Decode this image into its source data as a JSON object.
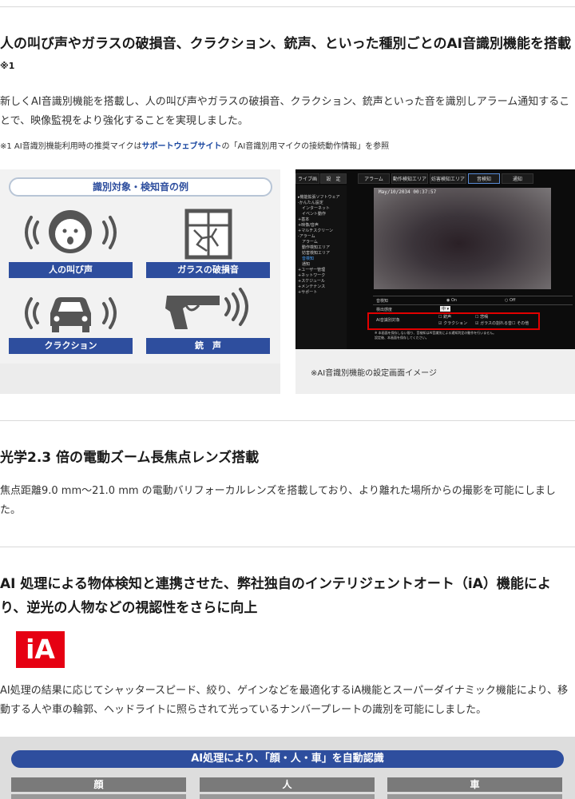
{
  "section1": {
    "heading": "人の叫び声やガラスの破損音、クラクション、銃声、といった種別ごとのAI音識別機能を搭載",
    "heading_sup": "※1",
    "body": "新しくAI音識別機能を搭載し、人の叫び声やガラスの破損音、クラクション、銃声といった音を識別しアラーム通知することで、映像監視をより強化することを実現しました。",
    "note_prefix": "※1 AI音識別機能利用時の推奨マイクは",
    "note_link": "サポートウェブサイト",
    "note_suffix": "の「AI音識別用マイクの接続動作情報」を参照"
  },
  "diagram": {
    "title": "識別対象・検知音の例",
    "items": [
      "人の叫び声",
      "ガラスの破損音",
      "クラクション",
      "銃　声"
    ]
  },
  "screenshot": {
    "tabs": [
      "ライブ画",
      "設　定",
      "アラーム",
      "動作検知エリア",
      "妨害検知エリア",
      "音検知",
      "通知"
    ],
    "sidebar": [
      "▸機能拡張ソフトウェア",
      "",
      "-かんたん設定",
      "　インターネット",
      "　イベント動作",
      "",
      "+基本",
      "+映像/音声",
      "+マルチスクリーン",
      "-アラーム",
      "　アラーム",
      "　動作検知エリア",
      "　妨害検知エリア",
      "　音検知",
      "　通知",
      "+ユーザー管理",
      "+ネットワーク",
      "+スケジュール",
      "+メンテナンス",
      "+サポート"
    ],
    "timestamp": "May/10/2034 00:37:57",
    "form": {
      "row1_label": "音検知",
      "row1_on": "On",
      "row1_off": "Off",
      "row2_label": "検出感度",
      "row2_value": "中",
      "row3_label": "AI音識別対象",
      "opt1": "銃声",
      "opt2": "悲鳴",
      "opt3": "クラクション",
      "opt4": "ガラスの割れる音",
      "opt5": "その他",
      "footnote1": "※ 本画面を保存しない限り、音検知はAI音識別による通知判定の動作を行いません。",
      "footnote2": "設定後、本画面を保存してください。"
    },
    "caption": "※AI音識別機能の設定画面イメージ"
  },
  "section2": {
    "heading": "光学2.3 倍の電動ズーム長焦点レンズ搭載",
    "body": "焦点距離9.0 mm～21.0 mm の電動バリフォーカルレンズを搭載しており、より離れた場所からの撮影を可能にしました。"
  },
  "section3": {
    "heading": "AI 処理による物体検知と連携させた、弊社独自のインテリジェントオート（iA）機能により、逆光の人物などの視認性をさらに向上",
    "logo_text": "iA",
    "body": "AI処理の結果に応じてシャッタースピード、絞り、ゲインなどを最適化するiA機能とスーパーダイナミック機能により、移動する人や車の輪郭、ヘッドライトに照らされて光っているナンバープレートの識別を可能にしました。"
  },
  "bottom_figure": {
    "title": "AI処理により、「顔・人・車」を自動認識",
    "columns": [
      "顔",
      "人",
      "車"
    ]
  },
  "colors": {
    "accent_blue": "#2e4e9e",
    "alert_red": "#e10000",
    "logo_red": "#e60012"
  }
}
